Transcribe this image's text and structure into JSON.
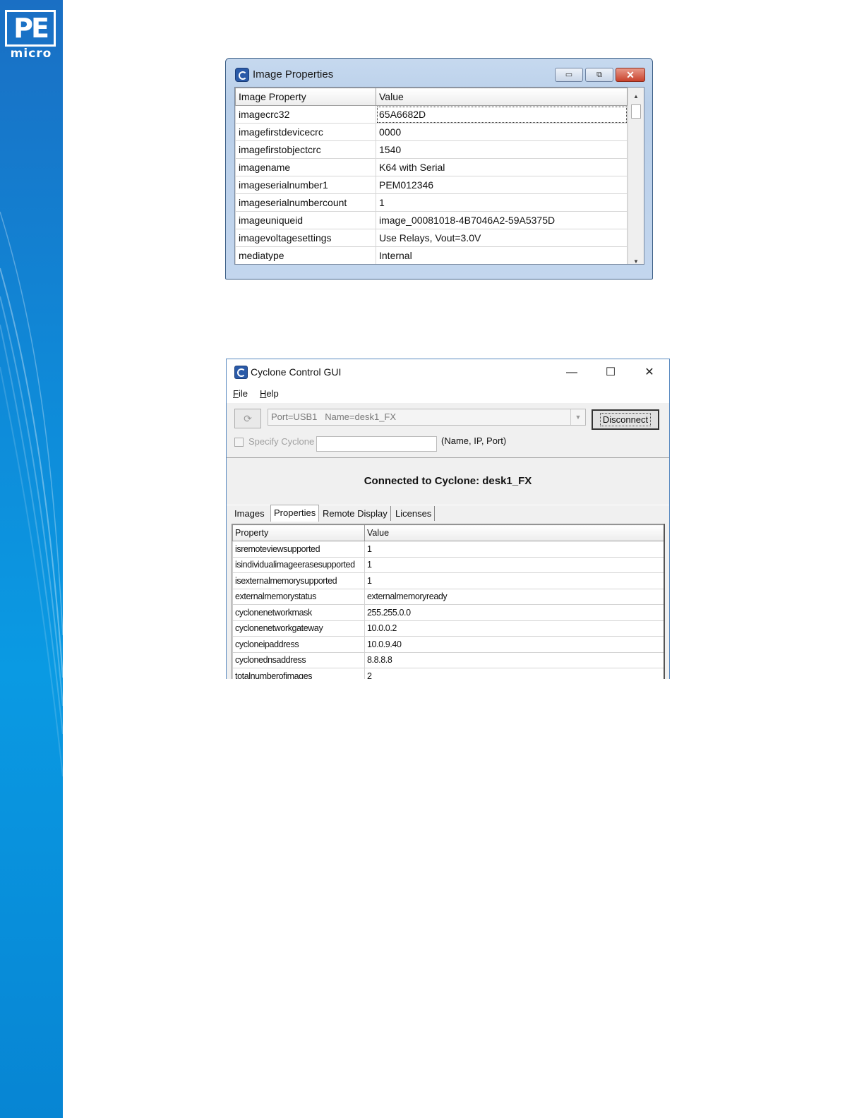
{
  "logo": {
    "pe": "PE",
    "micro": "micro"
  },
  "image_properties_window": {
    "title": "Image Properties",
    "controls": {
      "minimize": "▭",
      "maximize": "⧉",
      "close": "✕"
    },
    "columns": [
      "Image Property",
      "Value"
    ],
    "rows": [
      [
        "imagecrc32",
        "65A6682D"
      ],
      [
        "imagefirstdevicecrc",
        "0000"
      ],
      [
        "imagefirstobjectcrc",
        "1540"
      ],
      [
        "imagename",
        "K64 with Serial"
      ],
      [
        "imageserialnumber1",
        "PEM012346"
      ],
      [
        "imageserialnumbercount",
        "1"
      ],
      [
        "imageuniqueid",
        "image_00081018-4B7046A2-59A5375D"
      ],
      [
        "imagevoltagesettings",
        "Use Relays, Vout=3.0V"
      ],
      [
        "mediatype",
        "Internal"
      ]
    ]
  },
  "cyclone_window": {
    "title": "Cyclone Control GUI",
    "controls": {
      "minimize": "—",
      "maximize": "☐",
      "close": "✕"
    },
    "menu": {
      "file_first": "F",
      "file_rest": "ile",
      "help_first": "H",
      "help_rest": "elp"
    },
    "port_combo": "Port=USB1   Name=desk1_FX",
    "disconnect_label": "Disconnect",
    "specify_label": "Specify Cyclone",
    "specify_hint": "(Name, IP, Port)",
    "status": "Connected to Cyclone: desk1_FX",
    "tabs": [
      "Images",
      "Properties",
      "Remote Display",
      "Licenses"
    ],
    "active_tab": "Properties",
    "columns": [
      "Property",
      "Value"
    ],
    "rows": [
      [
        "isremoteviewsupported",
        "1"
      ],
      [
        "isindividualimageerasesupported",
        "1"
      ],
      [
        "isexternalmemorysupported",
        "1"
      ],
      [
        "externalmemorystatus",
        "externalmemoryready"
      ],
      [
        "cyclonenetworkmask",
        "255.255.0.0"
      ],
      [
        "cyclonenetworkgateway",
        "10.0.0.2"
      ],
      [
        "cycloneipaddress",
        "10.0.9.40"
      ],
      [
        "cyclonednsaddress",
        "8.8.8.8"
      ],
      [
        "totalnumberofimages",
        "2"
      ]
    ]
  }
}
